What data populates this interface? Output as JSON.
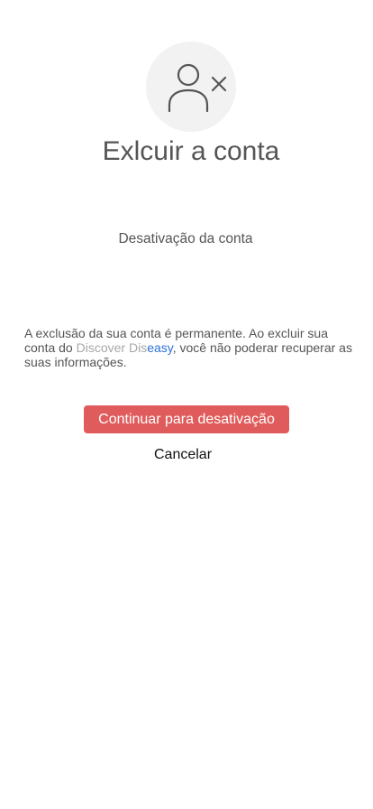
{
  "header": {
    "avatar_icon": "user-remove-icon",
    "title": "Exlcuir a conta"
  },
  "content": {
    "subtitle": "Desativação da conta",
    "description_part1": "A exclusão da sua conta é permanente. Ao excluir sua conta do ",
    "brand_part1": "Discover Dis",
    "brand_part2": "easy",
    "description_part2": ",  você não poderar recuperar as suas informações."
  },
  "actions": {
    "continue_label": "Continuar para desativação",
    "cancel_label": "Cancelar"
  },
  "colors": {
    "primary_button": "#e05c5c",
    "brand_accent": "#2a73d8",
    "brand_muted": "#a8a8a8",
    "text": "#555555",
    "avatar_bg": "#f2f2f2"
  }
}
